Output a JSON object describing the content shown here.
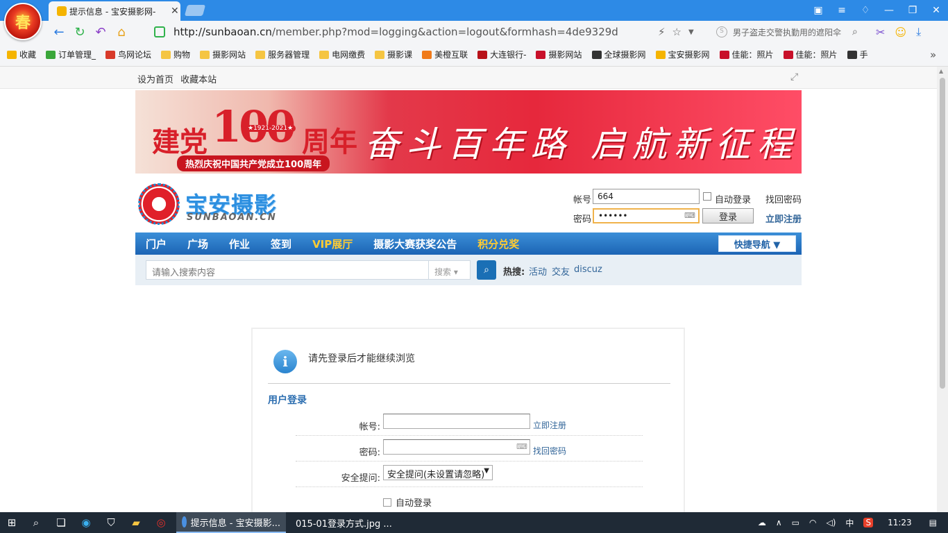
{
  "browser": {
    "tab_title": "提示信息 - 宝安摄影网-",
    "url_host": "http://sunbaoan.cn",
    "url_path": "/member.php?mod=logging&action=logout&formhash=4de9329d",
    "search_text": "男子盗走交警执勤用的遮阳伞",
    "logo_char": "春",
    "bookmarks": [
      {
        "label": "收藏",
        "icon": "star-icon",
        "color": "#f5b400"
      },
      {
        "label": "订单管理_",
        "icon": "puzzle-icon",
        "color": "#3aa63a"
      },
      {
        "label": "鸟网论坛",
        "icon": "bird-icon",
        "color": "#d83a2a"
      },
      {
        "label": "购物",
        "icon": "folder-icon",
        "color": "#f5c542"
      },
      {
        "label": "摄影网站",
        "icon": "folder-icon",
        "color": "#f5c542"
      },
      {
        "label": "服务器管理",
        "icon": "folder-icon",
        "color": "#f5c542"
      },
      {
        "label": "电网缴费",
        "icon": "folder-icon",
        "color": "#f5c542"
      },
      {
        "label": "摄影课",
        "icon": "folder-icon",
        "color": "#f5c542"
      },
      {
        "label": "美橙互联",
        "icon": "orange-icon",
        "color": "#f07a1a"
      },
      {
        "label": "大连银行-",
        "icon": "bank-icon",
        "color": "#b8121a"
      },
      {
        "label": "摄影网站",
        "icon": "photo-icon",
        "color": "#c8102a"
      },
      {
        "label": "全球摄影网",
        "icon": "globe-icon",
        "color": "#333333"
      },
      {
        "label": "宝安摄影网",
        "icon": "trophy-icon",
        "color": "#f5b400"
      },
      {
        "label": "佳能：照片",
        "icon": "canon-icon",
        "color": "#c8102a"
      },
      {
        "label": "佳能：照片",
        "icon": "canon-icon",
        "color": "#c8102a"
      },
      {
        "label": "手",
        "icon": "camera-icon",
        "color": "#333333"
      }
    ]
  },
  "site": {
    "top_links": [
      "设为首页",
      "收藏本站"
    ],
    "banner": {
      "left1": "建党",
      "num": "100",
      "left2": "周年",
      "years": "★1921-2021★",
      "sub": "热烈庆祝中国共产党成立100周年",
      "slogan": "奋斗百年路 启航新征程"
    },
    "logo_cn": "宝安摄影",
    "logo_en": "SUNBAOAN.CN",
    "quick_login": {
      "account_label": "帐号",
      "account_value": "664",
      "password_label": "密码",
      "password_value": "••••••",
      "auto_login": "自动登录",
      "forgot": "找回密码",
      "login_btn": "登录",
      "register": "立即注册"
    },
    "nav": [
      {
        "label": "门户",
        "vip": false
      },
      {
        "label": "广场",
        "vip": false
      },
      {
        "label": "作业",
        "vip": false
      },
      {
        "label": "签到",
        "vip": false
      },
      {
        "label": "VIP展厅",
        "vip": true
      },
      {
        "label": "摄影大赛获奖公告",
        "vip": false
      },
      {
        "label": "积分兑奖",
        "vip": true
      }
    ],
    "quick_nav": "快捷导航 ▼",
    "search": {
      "placeholder": "请输入搜索内容",
      "select": "搜索 ▾",
      "hot_label": "热搜:",
      "hot": [
        "活动",
        "交友",
        "discuz"
      ]
    }
  },
  "login_box": {
    "message": "请先登录后才能继续浏览",
    "section": "用户登录",
    "account_label": "帐号:",
    "password_label": "密码:",
    "question_label": "安全提问:",
    "question_value": "安全提问(未设置请忽略)",
    "register": "立即注册",
    "forgot": "找回密码",
    "auto_login": "自动登录"
  },
  "taskbar": {
    "tasks": [
      {
        "label": "提示信息 - 宝安摄影...",
        "active": true
      },
      {
        "label": "015-01登录方式.jpg ...",
        "active": false
      }
    ],
    "ime": "中",
    "time": "11:23"
  }
}
